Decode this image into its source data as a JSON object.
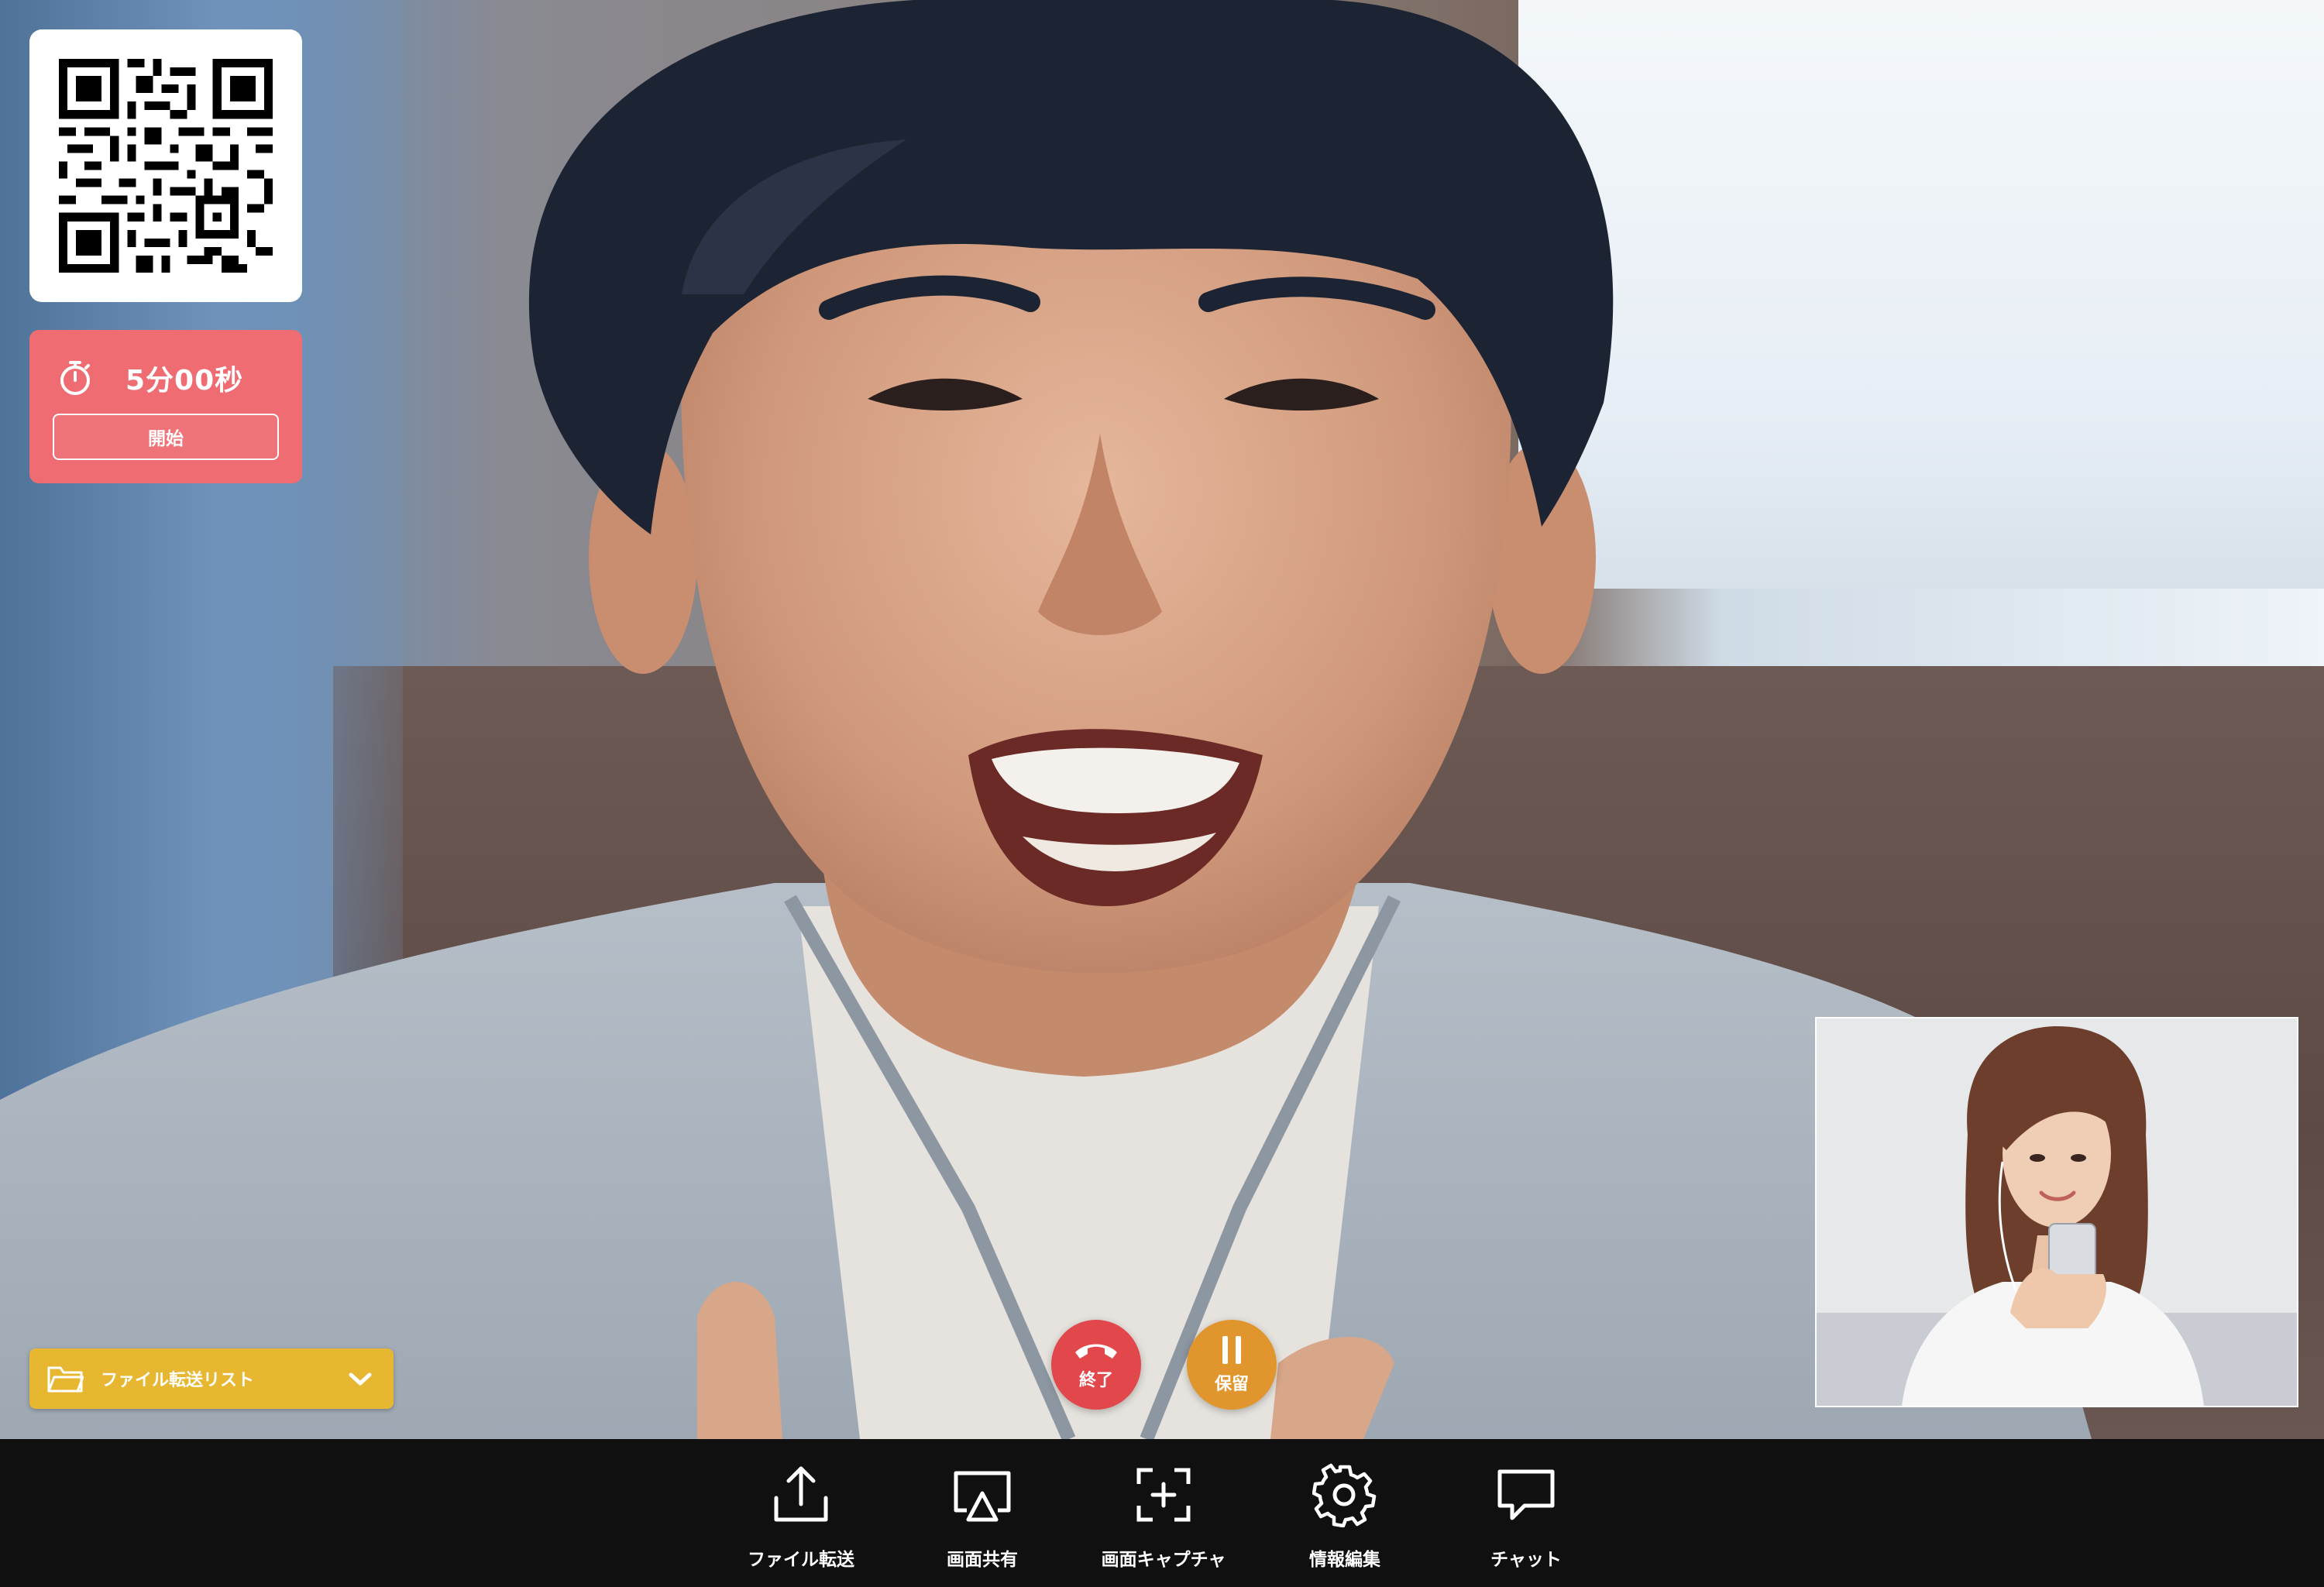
{
  "qr": {
    "icon": "qr-code-icon"
  },
  "timer": {
    "icon": "stopwatch-icon",
    "time": "5分00秒",
    "start_label": "開始"
  },
  "file_list": {
    "label": "ファイル転送リスト",
    "icon": "folder-icon",
    "chevron": "chevron-down-icon"
  },
  "call_controls": {
    "end": {
      "label": "終了",
      "icon": "hang-up-icon",
      "color": "#e2474b"
    },
    "hold": {
      "label": "保留",
      "icon": "pause-icon",
      "color": "#e0962d"
    }
  },
  "toolbar": {
    "items": [
      {
        "label": "ファイル転送",
        "icon": "upload-icon"
      },
      {
        "label": "画面共有",
        "icon": "screen-share-icon"
      },
      {
        "label": "画面キャプチャ",
        "icon": "screen-capture-icon"
      },
      {
        "label": "情報編集",
        "icon": "gear-icon"
      },
      {
        "label": "チャット",
        "icon": "chat-icon"
      }
    ]
  },
  "colors": {
    "timer_bg": "#ee6c72",
    "file_list_bg": "#e7b732",
    "toolbar_bg": "#101010"
  }
}
